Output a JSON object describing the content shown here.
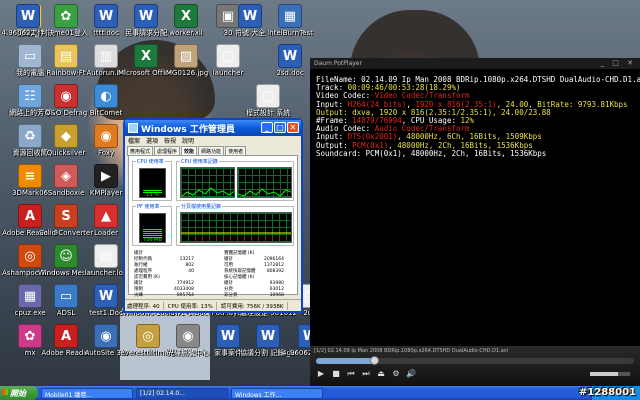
{
  "desktop": {
    "icons": [
      {
        "label": "我的文件",
        "glyph": "▤",
        "color": "#e8c45a"
      },
      {
        "label": "Game01登入",
        "glyph": "✿",
        "color": "#3aa043"
      },
      {
        "label": "tttt.doc",
        "glyph": "W",
        "color": "#2b5fb8"
      },
      {
        "label": "民事請求分配",
        "glyph": "W",
        "color": "#2b5fb8"
      },
      {
        "label": "worker.xll",
        "glyph": "X",
        "color": "#1e7a3c"
      },
      {
        "label": "30",
        "glyph": "▣",
        "color": "#777"
      },
      {
        "label": "我的電腦",
        "glyph": "▭",
        "color": "#9fb7d3"
      },
      {
        "label": "Rainbow-Ft",
        "glyph": "▤",
        "color": "#e8c45a"
      },
      {
        "label": "Autorun.inf",
        "glyph": "▥",
        "color": "#ddd"
      },
      {
        "label": "Microsoft Office Ex",
        "glyph": "X",
        "color": "#1e7a3c"
      },
      {
        "label": "IMG0126.jpg",
        "glyph": "▨",
        "color": "#bda27a"
      },
      {
        "label": "launcher",
        "glyph": "▢",
        "color": "#eee"
      },
      {
        "label": "網路上的芳鄰",
        "glyph": "☷",
        "color": "#6ea5da"
      },
      {
        "label": "O&O Defrag",
        "glyph": "◉",
        "color": "#c93030"
      },
      {
        "label": "BitComet",
        "glyph": "◐",
        "color": "#3b8bd8"
      },
      {
        "label": "資源回收筒",
        "glyph": "♻",
        "color": "#8aa8c8"
      },
      {
        "label": "Quicksilver",
        "glyph": "◆",
        "color": "#c8a030"
      },
      {
        "label": "Foxy",
        "glyph": "◉",
        "color": "#e07a20"
      },
      {
        "label": "3DMark06",
        "glyph": "≡",
        "color": "#f08a00"
      },
      {
        "label": "Sandboxie",
        "glyph": "◈",
        "color": "#d05a5a"
      },
      {
        "label": "KMPlayer",
        "glyph": "▶",
        "color": "#222"
      },
      {
        "label": "Adobe Reader 9",
        "glyph": "A",
        "color": "#c8201e"
      },
      {
        "label": "Solid Converter",
        "glyph": "S",
        "color": "#c84020"
      },
      {
        "label": "Loader",
        "glyph": "▲",
        "color": "#d83030"
      },
      {
        "label": "Ashampoo Burning",
        "glyph": "◎",
        "color": "#d04a10"
      },
      {
        "label": "Windows Messenger",
        "glyph": "☺",
        "color": "#2d8a2d"
      },
      {
        "label": "launcher.log",
        "glyph": "▤",
        "color": "#eee"
      },
      {
        "label": "cpuz.exe",
        "glyph": "▦",
        "color": "#6a6aaa"
      },
      {
        "label": "ADSL",
        "glyph": "▭",
        "color": "#3b7bc8"
      },
      {
        "label": "test1.Doc",
        "glyph": "W",
        "color": "#2b5fb8"
      },
      {
        "label": "Windows 2000",
        "glyph": "▢",
        "color": "#888"
      },
      {
        "label": "law1-1.Doc",
        "glyph": "W",
        "color": "#2b5fb8"
      },
      {
        "label": "PotPlayer",
        "glyph": "▶",
        "color": "#f5c800"
      },
      {
        "label": "處理設定 961012.doc",
        "glyph": "W",
        "color": "#2b5fb8"
      },
      {
        "label": "2u4",
        "glyph": "▢",
        "color": "#eee"
      },
      {
        "label": "mx",
        "glyph": "✿",
        "color": "#cc3a8a"
      },
      {
        "label": "Adobe Reader",
        "glyph": "A",
        "color": "#c8201e"
      },
      {
        "label": "AutoSite 3.0",
        "glyph": "◉",
        "color": "#3b6fb8"
      },
      {
        "label": "everestultimate",
        "glyph": "◎",
        "color": "#c4a040"
      },
      {
        "label": "光碟訊號中心",
        "glyph": "◉",
        "color": "#888"
      },
      {
        "label": "家事案件",
        "glyph": "W",
        "color": "#2b5fb8"
      },
      {
        "label": "協議分割 記錄.doc",
        "glyph": "W",
        "color": "#2b5fb8"
      },
      {
        "label": "4_960622_ 行號 全判",
        "glyph": "W",
        "color": "#2b5fb8"
      },
      {
        "label": "符號 大全",
        "glyph": "W",
        "color": "#2b5fb8"
      },
      {
        "label": "IntelBurnTest",
        "glyph": "▦",
        "color": "#3b6fb8"
      },
      {
        "label": "2sd.doc",
        "glyph": "W",
        "color": "#2b5fb8"
      },
      {
        "label": "程式設計 系統",
        "glyph": "▢",
        "color": "#eee"
      },
      {
        "label": "4.960622_ 判決",
        "glyph": "W",
        "color": "#2b5fb8"
      }
    ]
  },
  "task_manager": {
    "title": "Windows 工作管理員",
    "menu": [
      "檔案",
      "選項",
      "檢視",
      "說明"
    ],
    "tabs": [
      "應用程式",
      "處理程序",
      "效能",
      "網路功能",
      "使用者"
    ],
    "cpu_usage_label": "CPU 使用率",
    "cpu_history_label": "CPU 使用率記錄",
    "pf_usage_label": "PF 使用率",
    "pf_history_label": "分頁檔使用量記錄",
    "cpu_percent": 0.13,
    "cpu_value": "13 %",
    "pf_value": "756 MB",
    "pf_level": 0.35,
    "totals": {
      "title": "總計",
      "rows": [
        [
          "控制代碼",
          "13217"
        ],
        [
          "執行緒",
          "802"
        ],
        [
          "處理程序",
          "40"
        ]
      ]
    },
    "physical": {
      "title": "實體記憶體 (K)",
      "rows": [
        [
          "總計",
          "2096164"
        ],
        [
          "可用",
          "1372812"
        ],
        [
          "系統快取記憶體",
          "808392"
        ]
      ]
    },
    "commit": {
      "title": "認可費用 (K)",
      "rows": [
        [
          "總計",
          "774912"
        ],
        [
          "限制",
          "4033408"
        ],
        [
          "尖峰",
          "895764"
        ]
      ]
    },
    "kernel": {
      "title": "核心記憶體 (K)",
      "rows": [
        [
          "總計",
          "93980"
        ],
        [
          "分頁",
          "63012"
        ],
        [
          "非分頁",
          "30968"
        ]
      ]
    },
    "status": {
      "processes": "處理程序: 40",
      "cpu": "CPU 使用率: 13%",
      "commit": "認可費用: 756K / 3938K"
    }
  },
  "player": {
    "title": "Daum PotPlayer",
    "title_controls": "_ □ ✕",
    "osd": [
      {
        "parts": [
          {
            "t": "FileName: 02.14.09 Ip Man 2008 BDRip.1080p.x264.DTSHD DualAudio-CHD.D1.avi",
            "c": "w"
          }
        ]
      },
      {
        "parts": [
          {
            "t": "Track: ",
            "c": "w"
          },
          {
            "t": "00:09:46/00:53:28(18.29%)",
            "c": "y"
          }
        ]
      },
      {
        "parts": [
          {
            "t": "Video Codec: ",
            "c": "w"
          },
          {
            "t": "Video Codec/Transform",
            "c": "r"
          }
        ]
      },
      {
        "parts": [
          {
            "t": "Input: ",
            "c": "w"
          },
          {
            "t": "H264(24 bits)",
            "c": "r"
          },
          {
            "t": ", ",
            "c": "w"
          },
          {
            "t": "1920 x 816(2.35:1)",
            "c": "r"
          },
          {
            "t": ", 24.00, BitRate: 9793.81Kbps",
            "c": "y"
          }
        ]
      },
      {
        "parts": [
          {
            "t": "Output: dxva, 1920 x 816(2.35:1/2.35:1), 24.00/23.88",
            "c": "y"
          }
        ]
      },
      {
        "parts": [
          {
            "t": "#Frame: ",
            "c": "w"
          },
          {
            "t": "14079/76994",
            "c": "r"
          },
          {
            "t": ", CPU Usage: ",
            "c": "w"
          },
          {
            "t": "12%",
            "c": "y"
          }
        ]
      },
      {
        "parts": [
          {
            "t": "Audio Codec: ",
            "c": "w"
          },
          {
            "t": "Audio Codec/Transform",
            "c": "r"
          }
        ]
      },
      {
        "parts": [
          {
            "t": "Input: ",
            "c": "w"
          },
          {
            "t": "DTS(0x2001)",
            "c": "r"
          },
          {
            "t": ", 48000Hz, 6Ch, 16Bits, 1509Kbps",
            "c": "y"
          }
        ]
      },
      {
        "parts": [
          {
            "t": "Output: ",
            "c": "w"
          },
          {
            "t": "PCM(0x1)",
            "c": "r"
          },
          {
            "t": ", 48000Hz, 2Ch, 16Bits, 1536Kbps",
            "c": "y"
          }
        ]
      },
      {
        "parts": [
          {
            "t": "Soundcard: PCM(0x1), 48000Hz, 2Ch, 16Bits, 1536Kbps",
            "c": "w"
          }
        ]
      }
    ],
    "status_line": "[1/2] 02.14.09 Ip Man 2008 BDRip.1080p.x264.DTSHD DualAudio-CHD.D1.avi",
    "progress": 0.1829,
    "volume": 0.7,
    "controls": [
      "▶",
      "■",
      "⏮",
      "⏭",
      "⏏",
      "⚙",
      "🔊"
    ]
  },
  "taskbar": {
    "start_label": "開始",
    "buttons": [
      "Mobile01 議壇...",
      "[1/2] 02.14.0...",
      "Windows 工作..."
    ],
    "clock": "下午 03:06"
  },
  "watermark": "#1288001"
}
